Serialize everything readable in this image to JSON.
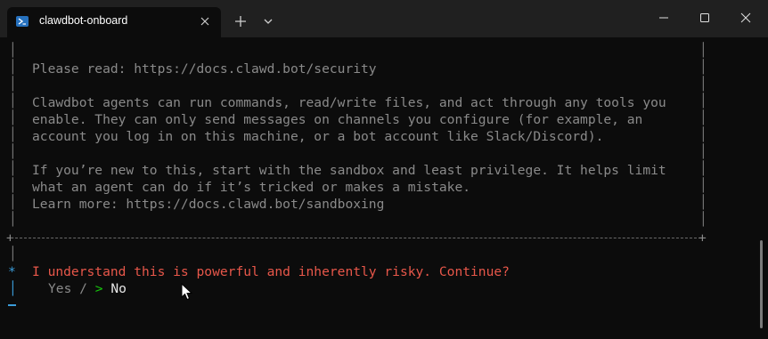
{
  "window": {
    "tab_title": "clawdbot-onboard",
    "tab_icon": "powershell-icon",
    "colors": {
      "titlebar": "#202020",
      "background": "#0c0c0c",
      "text": "#8a8a8a",
      "prompt": "#e8574a",
      "star": "#3b9cd9",
      "arrow": "#16c60c"
    }
  },
  "terminal": {
    "lines": [
      "Please read: https://docs.clawd.bot/security",
      "",
      "Clawdbot agents can run commands, read/write files, and act through any tools you",
      "enable. They can only send messages on channels you configure (for example, an",
      "account you log in on this machine, or a bot account like Slack/Discord).",
      "",
      "If you’re new to this, start with the sandbox and least privilege. It helps limit",
      "what an agent can do if it’s tricked or makes a mistake.",
      "Learn more: https://docs.clawd.bot/sandboxing"
    ],
    "prompt_marker": "*",
    "prompt": "I understand this is powerful and inherently risky. Continue?",
    "option_yes": "Yes",
    "option_separator": "/",
    "option_arrow": ">",
    "option_no": "No"
  }
}
